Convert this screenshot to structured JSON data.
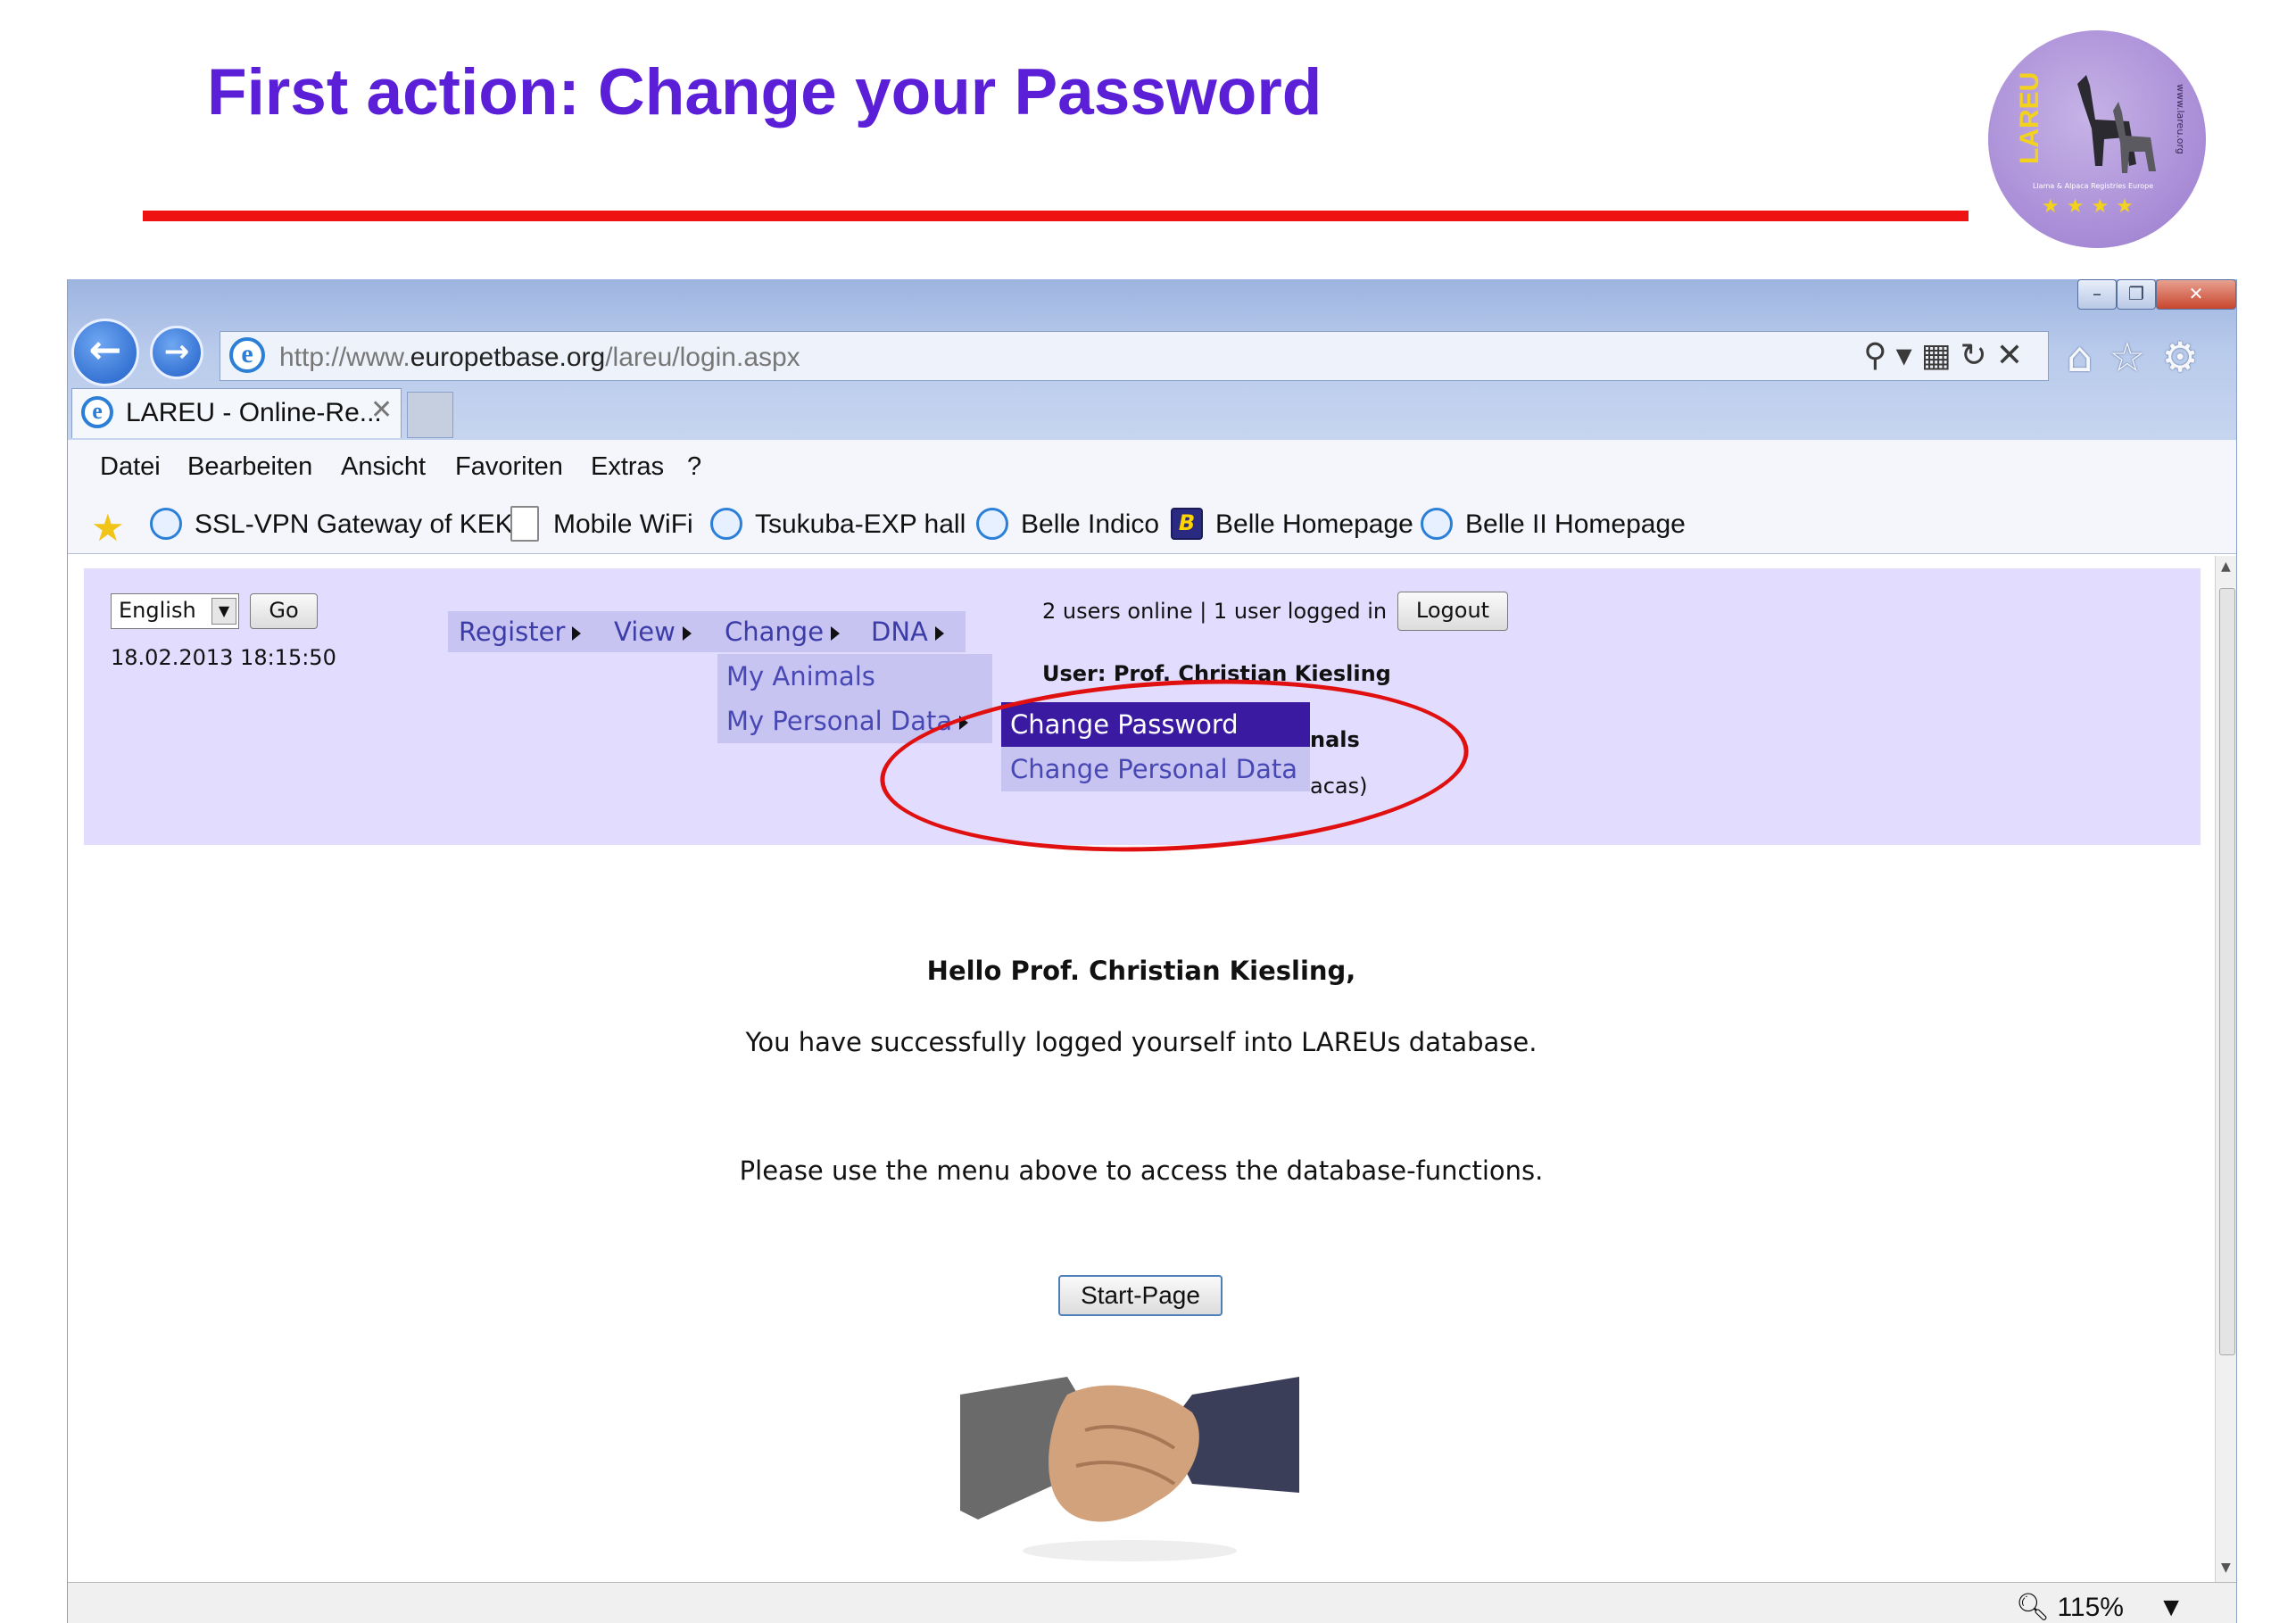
{
  "slide": {
    "title": "First action: Change your Password",
    "logo_text": "LAREU",
    "logo_url": "www.lareu.org",
    "logo_subtitle": "Llama & Alpaca Registries Europe"
  },
  "browser": {
    "url_prefix": "http://www.",
    "url_domain": "europetbase.org",
    "url_path": "/lareu/login.aspx",
    "tab_title": "LAREU - Online-Re...",
    "menu": [
      "Datei",
      "Bearbeiten",
      "Ansicht",
      "Favoriten",
      "Extras",
      "?"
    ],
    "favorites": [
      "SSL-VPN Gateway of KEK",
      "Mobile WiFi",
      "Tsukuba-EXP hall",
      "Belle Indico",
      "Belle Homepage",
      "Belle II Homepage"
    ],
    "zoom": "115%"
  },
  "page": {
    "language": "English",
    "go": "Go",
    "datetime": "18.02.2013 18:15:50",
    "nav": {
      "register": "Register",
      "view": "View",
      "change": "Change",
      "dna": "DNA"
    },
    "change_menu": {
      "my_animals": "My Animals",
      "my_personal_data": "My Personal Data"
    },
    "personal_menu": {
      "change_password": "Change Password",
      "change_personal_data": "Change Personal Data"
    },
    "online_status": "2 users online | 1 user logged in",
    "logout": "Logout",
    "user": "User: Prof. Christian Kiesling",
    "partial_1": "nals",
    "partial_2": "acas)",
    "hello": "Hello Prof. Christian Kiesling,",
    "message_1": "You have successfully logged yourself into LAREUs database.",
    "message_2": "Please use the menu above to access the database-functions.",
    "start_page": "Start-Page"
  },
  "colors": {
    "title": "#5a1fd6",
    "rule": "#ee1212",
    "panel": "#e2dcff",
    "highlight": "#3a1aa0",
    "annotation": "#e01010"
  }
}
